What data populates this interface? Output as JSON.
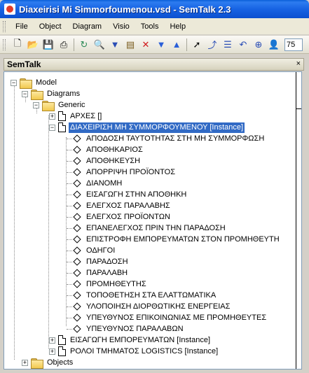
{
  "window": {
    "title": "Diaxeirisi Mi Simmorfoumenou.vsd - SemTalk 2.3"
  },
  "menubar": {
    "items": [
      "File",
      "Object",
      "Diagram",
      "Visio",
      "Tools",
      "Help"
    ]
  },
  "toolbar": {
    "zoom": "75 %"
  },
  "panel": {
    "title": "SemTalk",
    "close": "×"
  },
  "tree": {
    "model": "Model",
    "diagrams": "Diagrams",
    "generic": "Generic",
    "arxes": "ΑΡΧΕΣ []",
    "selected": "ΔΙΑΧΕΙΡΙΣΗ ΜΗ ΣΥΜΜΟΡΦΟΥΜΕΝΟΥ [Instance]",
    "children": [
      "ΑΠΟΔΟΣΗ ΤΑΥΤΟΤΗΤΑΣ ΣΤΗ ΜΗ ΣΥΜΜΟΡΦΩΣΗ",
      "ΑΠΟΘΗΚΑΡΙΟΣ",
      "ΑΠΟΘΗΚΕΥΣΗ",
      "ΑΠΟΡΡΙΨΗ ΠΡΟΪΟΝΤΟΣ",
      "ΔΙΑΝΟΜΗ",
      "ΕΙΣΑΓΩΓΗ ΣΤΗΝ ΑΠΟΘΗΚΗ",
      "ΕΛΕΓΧΟΣ ΠΑΡΑΛΑΒΗΣ",
      "ΕΛΕΓΧΟΣ ΠΡΟΪΟΝΤΩΝ",
      "ΕΠΑΝΕΛΕΓΧΟΣ ΠΡΙΝ ΤΗΝ ΠΑΡΑΔΟΣΗ",
      "ΕΠΙΣΤΡΟΦΗ ΕΜΠΟΡΕΥΜΑΤΩΝ ΣΤΟΝ ΠΡΟΜΗΘΕΥΤΗ",
      "ΟΔΗΓΟΙ",
      "ΠΑΡΑΔΟΣΗ",
      "ΠΑΡΑΛΑΒΗ",
      "ΠΡΟΜΗΘΕΥΤΗΣ",
      "ΤΟΠΟΘΕΤΗΣΗ ΣΤΑ ΕΛΑΤΤΩΜΑΤΙΚΑ",
      "ΥΛΟΠΟΙΗΣΗ ΔΙΟΡΘΩΤΙΚΗΣ ΕΝΕΡΓΕΙΑΣ",
      "ΥΠΕΥΘΥΝΟΣ ΕΠΙΚΟΙΝΩΝΙΑΣ ΜΕ ΠΡΟΜΗΘΕΥΤΕΣ",
      "ΥΠΕΥΘΥΝΟΣ ΠΑΡΑΛΑΒΩΝ"
    ],
    "eisagogi": "ΕΙΣΑΓΩΓΗ ΕΜΠΟΡΕΥΜΑΤΩΝ [Instance]",
    "roloi": "ΡΟΛΟΙ ΤΜΗΜΑΤΟΣ LOGISTICS [Instance]",
    "objects": "Objects"
  },
  "colors": {
    "selection": "#316ac5",
    "titlebar": "#0a5fd8"
  }
}
